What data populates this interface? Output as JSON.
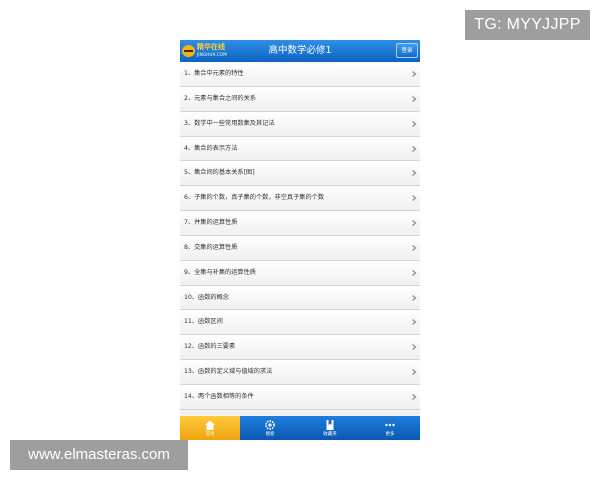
{
  "watermarks": {
    "top": "TG: MYYJJPP",
    "bottom": "www.elmasteras.com"
  },
  "header": {
    "logo_cn": "精华在线",
    "logo_en": "JINGHUA.COM",
    "title": "高中数学必修1",
    "login_label": "登录"
  },
  "list": {
    "items": [
      {
        "label": "1、集合中元素的特性",
        "icon": "chevron-right-icon"
      },
      {
        "label": "2、元素与集合之间的关系",
        "icon": "chevron-right-icon"
      },
      {
        "label": "3、数学中一些常用数集及其记法",
        "icon": "chevron-right-icon"
      },
      {
        "label": "4、集合的表示方法",
        "icon": "chevron-right-icon"
      },
      {
        "label": "5、集合间的基本关系[图]",
        "icon": "chevron-right-icon"
      },
      {
        "label": "6、子集的个数，真子集的个数，非空真子集的个数",
        "icon": "chevron-right-icon"
      },
      {
        "label": "7、并集的运算性质",
        "icon": "chevron-right-icon"
      },
      {
        "label": "8、交集的运算性质",
        "icon": "chevron-right-icon"
      },
      {
        "label": "9、全集与补集的运算性质",
        "icon": "chevron-right-icon"
      },
      {
        "label": "10、函数的概念",
        "icon": "chevron-right-icon"
      },
      {
        "label": "11、函数区间",
        "icon": "chevron-right-icon"
      },
      {
        "label": "12、函数的三要素",
        "icon": "chevron-right-icon"
      },
      {
        "label": "13、函数的定义域与值域的求法",
        "icon": "chevron-right-icon"
      },
      {
        "label": "14、两个函数相等的条件",
        "icon": "chevron-right-icon"
      }
    ]
  },
  "tabbar": {
    "tabs": [
      {
        "label": "首页",
        "icon": "home-icon",
        "active": true
      },
      {
        "label": "搜索",
        "icon": "gear-icon",
        "active": false
      },
      {
        "label": "收藏夹",
        "icon": "bookmark-icon",
        "active": false
      },
      {
        "label": "更多",
        "icon": "more-icon",
        "active": false
      }
    ]
  },
  "colors": {
    "header": "#1a76d6",
    "active_tab": "#f6b21a",
    "chevron": "#8a8a8a"
  }
}
